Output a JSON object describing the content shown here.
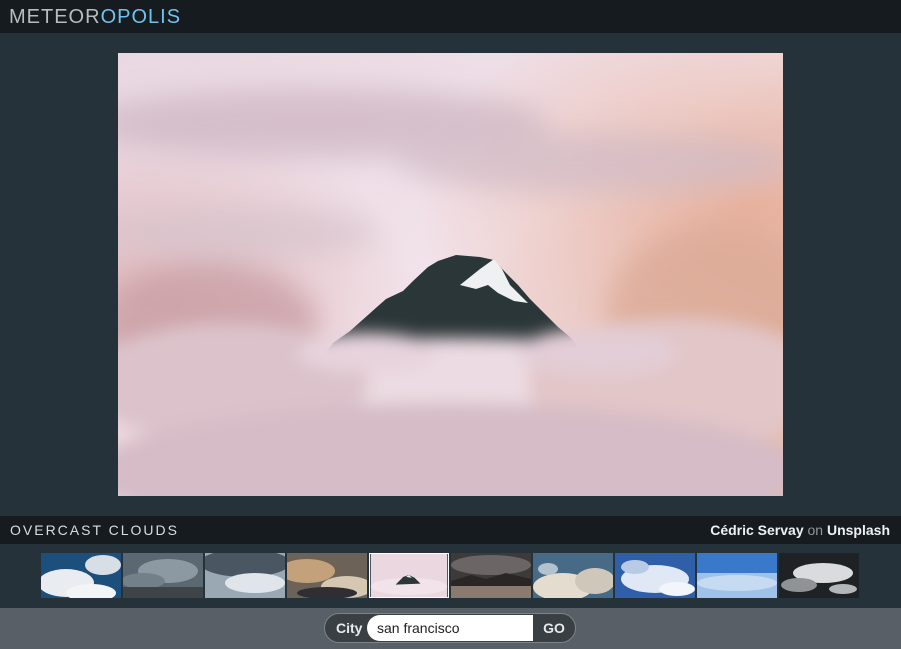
{
  "header": {
    "logo_part1": "METEOR",
    "logo_part2": "OPOLIS"
  },
  "photo": {
    "description_label": "OVERCAST CLOUDS",
    "photographer": "Cédric Servay",
    "credit_joiner": "on",
    "source": "Unsplash"
  },
  "thumbnails": {
    "count": 10,
    "selected_index": 4
  },
  "search": {
    "label": "City",
    "value": "san francisco",
    "button_label": "GO"
  },
  "colors": {
    "header_bg": "#161b1f",
    "page_bg": "#26323a",
    "footer_bg": "#595f66",
    "logo_accent": "#6ec3ee"
  }
}
